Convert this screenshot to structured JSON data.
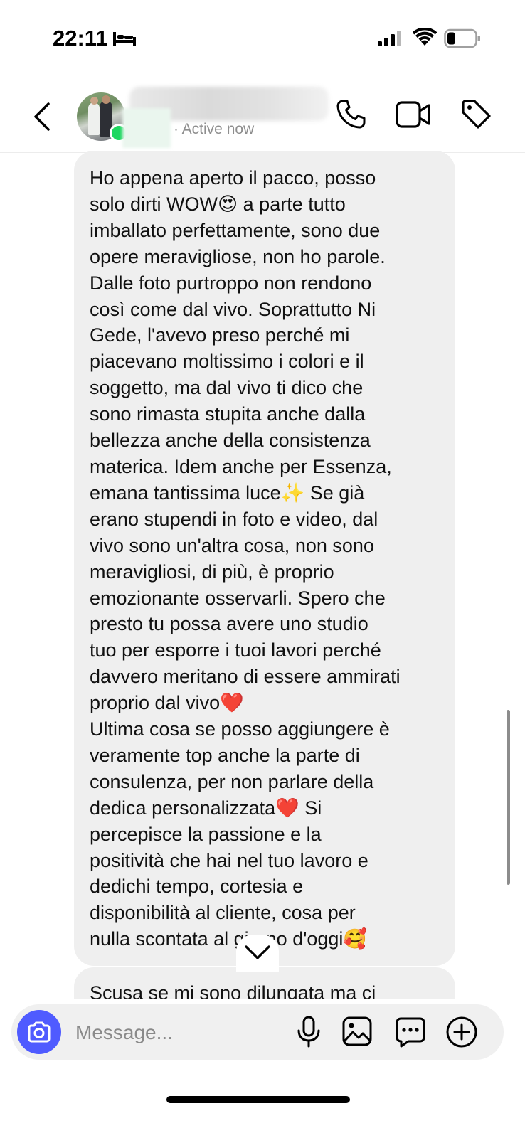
{
  "status_bar": {
    "time": "22:11",
    "icons": [
      "bed-icon",
      "signal-icon",
      "wifi-icon",
      "battery-icon"
    ]
  },
  "header": {
    "presence": "· Active now",
    "icons": [
      "back-icon",
      "call-icon",
      "video-call-icon",
      "tag-icon"
    ],
    "online_color": "#1ed760"
  },
  "messages": [
    {
      "text": "Ho appena aperto il pacco, posso\nsolo dirti WOW😍 a parte tutto\nimballato perfettamente, sono due\nopere meravigliose, non ho parole.\nDalle foto purtroppo non rendono\ncosì come dal vivo. Soprattutto Ni\nGede, l'avevo preso perché mi\npiacevano moltissimo i colori e il\nsoggetto, ma dal vivo ti dico che\nsono rimasta stupita anche dalla\nbellezza anche della consistenza\nmaterica. Idem anche per Essenza,\nemana tantissima luce✨ Se già\nerano stupendi in foto e video, dal\nvivo sono un'altra cosa, non sono\nmeravigliosi, di più, è proprio\nemozionante osservarli. Spero che\npresto tu possa avere uno studio\ntuo per esporre i tuoi lavori perché\ndavvero meritano di essere ammirati\nproprio dal vivo❤️\nUltima cosa se posso aggiungere è\nveramente top anche la parte di\nconsulenza, per non parlare della\ndedica personalizzata❤️ Si\npercepisce la passione e la\npositività che hai nel tuo lavoro e\ndedichi tempo, cortesia e\ndisponibilità al cliente, cosa per\nnulla scontata al giorno d'oggi🥰"
    },
    {
      "text": "Scusa se mi sono dilungata ma ci"
    }
  ],
  "composer": {
    "placeholder": "Message...",
    "icons": [
      "camera-icon",
      "microphone-icon",
      "gallery-icon",
      "sticker-icon",
      "plus-icon"
    ],
    "accent": "#4f5bff"
  }
}
